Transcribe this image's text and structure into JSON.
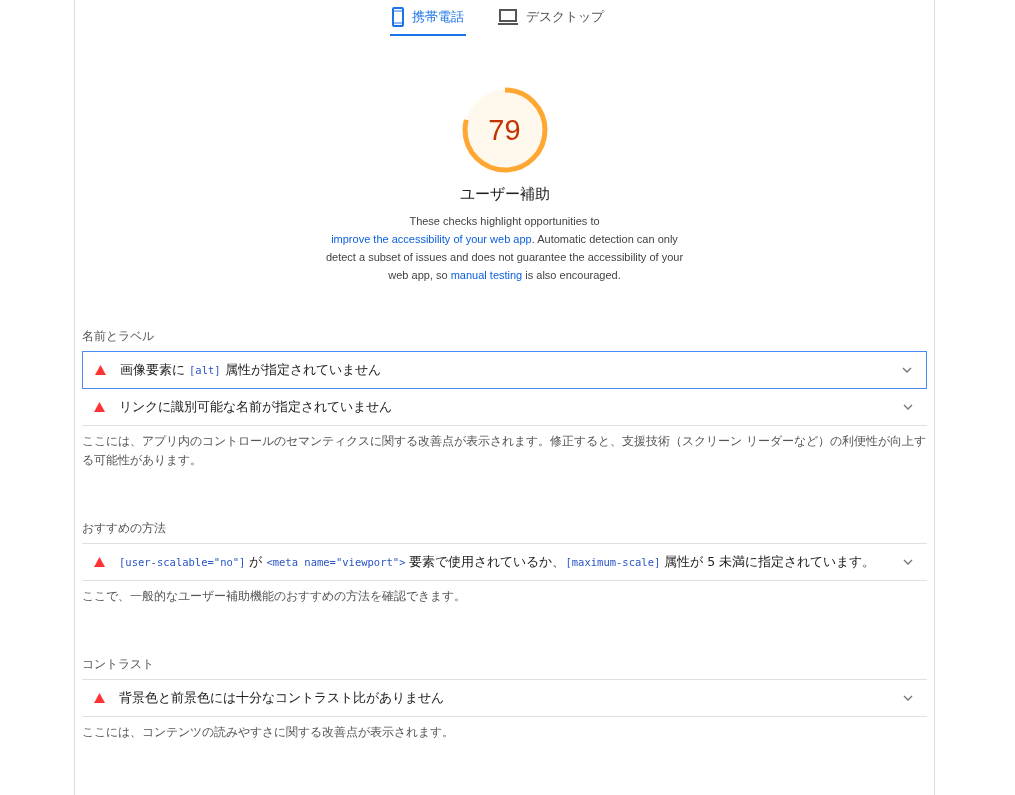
{
  "tabs": [
    {
      "label": "携帯電話",
      "kind": "phone",
      "selected": true
    },
    {
      "label": "デスクトップ",
      "kind": "desktop",
      "selected": false
    }
  ],
  "score": {
    "value": "79",
    "level": 0.79,
    "title": "ユーザー補助",
    "description": [
      {
        "kind": "text",
        "text": "These checks highlight opportunities to "
      },
      {
        "kind": "link",
        "text": "improve the accessibility of your web app"
      },
      {
        "kind": "text",
        "text": ". Automatic detection can only detect a subset of issues and does not guarantee the accessibility of your web app, so "
      },
      {
        "kind": "link",
        "text": "manual testing"
      },
      {
        "kind": "text",
        "text": " is also encouraged."
      }
    ]
  },
  "groups": [
    {
      "heading": "名前とラベル",
      "audits": [
        {
          "focused": true,
          "title": [
            {
              "kind": "text",
              "text": "画像要素に "
            },
            {
              "kind": "code",
              "text": "[alt]"
            },
            {
              "kind": "text",
              "text": " 属性が指定されていません"
            }
          ]
        },
        {
          "focused": false,
          "title": [
            {
              "kind": "text",
              "text": "リンクに識別可能な名前が指定されていません"
            }
          ]
        }
      ],
      "description": "ここには、アプリ内のコントロールのセマンティクスに関する改善点が表示されます。修正すると、支援技術（スクリーン リーダーなど）の利便性が向上する可能性があります。"
    },
    {
      "heading": "おすすめの方法",
      "audits": [
        {
          "focused": false,
          "title": [
            {
              "kind": "code",
              "text": "[user-scalable=\"no\"]"
            },
            {
              "kind": "text",
              "text": " が "
            },
            {
              "kind": "code",
              "text": "<meta name=\"viewport\">"
            },
            {
              "kind": "text",
              "text": " 要素で使用されているか、"
            },
            {
              "kind": "code",
              "text": "[maximum-scale]"
            },
            {
              "kind": "text",
              "text": " 属性が 5 未満に指定されています。"
            }
          ]
        }
      ],
      "description": "ここで、一般的なユーザー補助機能のおすすめの方法を確認できます。"
    },
    {
      "heading": "コントラスト",
      "audits": [
        {
          "focused": false,
          "title": [
            {
              "kind": "text",
              "text": "背景色と前景色には十分なコントラスト比がありません"
            }
          ]
        }
      ],
      "description": "ここには、コンテンツの読みやすさに関する改善点が表示されます。"
    }
  ]
}
